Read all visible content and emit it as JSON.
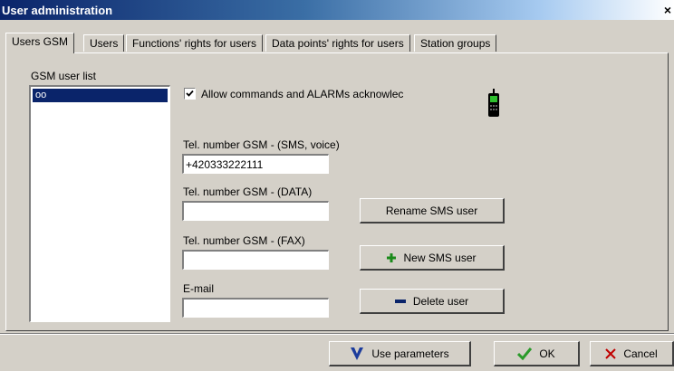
{
  "window": {
    "title": "User administration",
    "close_glyph": "×"
  },
  "tabs": [
    {
      "label": "Users GSM",
      "active": true
    },
    {
      "label": "Users",
      "active": false
    },
    {
      "label": "Functions' rights for users",
      "active": false
    },
    {
      "label": "Data points' rights for users",
      "active": false
    },
    {
      "label": "Station groups",
      "active": false
    }
  ],
  "gsm_list": {
    "label": "GSM user list",
    "items": [
      "oo"
    ],
    "selected": "oo"
  },
  "allow_commands": {
    "label": "Allow commands and ALARMs acknowlec",
    "checked": true
  },
  "fields": {
    "sms_voice": {
      "label": "Tel. number GSM - (SMS, voice)",
      "value": "+420333222111"
    },
    "data": {
      "label": "Tel. number GSM - (DATA)",
      "value": ""
    },
    "fax": {
      "label": "Tel. number GSM - (FAX)",
      "value": ""
    },
    "email": {
      "label": "E-mail",
      "value": ""
    }
  },
  "buttons": {
    "rename": "Rename SMS user",
    "new": "New SMS user",
    "delete": "Delete user",
    "use_parameters": "Use parameters",
    "ok": "OK",
    "cancel": "Cancel"
  },
  "icons": {
    "phone": "mobile-phone-icon",
    "plus": "plus-icon",
    "minus": "minus-icon",
    "use_parameters": "blue-v-icon",
    "ok": "green-check-icon",
    "cancel": "red-x-icon"
  },
  "colors": {
    "plus": "#1a8a1a",
    "minus": "#0a246a",
    "v_mark": "#1c3c9c",
    "check": "#2a9a2a",
    "cancel_x": "#c00000",
    "selection": "#0a246a"
  }
}
